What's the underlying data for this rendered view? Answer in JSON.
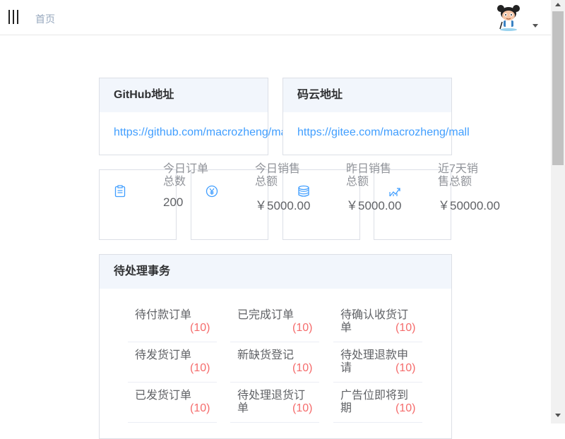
{
  "header": {
    "breadcrumb": "首页"
  },
  "addresses": [
    {
      "title": "GitHub地址",
      "link": "https://github.com/macrozheng/mall"
    },
    {
      "title": "码云地址",
      "link": "https://gitee.com/macrozheng/mall"
    }
  ],
  "stats": [
    {
      "label": "今日订单总数",
      "value": "200",
      "icon": "clipboard-icon"
    },
    {
      "label": "今日销售总额",
      "value": "￥5000.00",
      "icon": "yen-coin-icon"
    },
    {
      "label": "昨日销售总额",
      "value": "￥5000.00",
      "icon": "coin-stack-icon"
    },
    {
      "label": "近7天销售总额",
      "value": "￥50000.00",
      "icon": "trend-chart-icon"
    }
  ],
  "pending": {
    "title": "待处理事务",
    "items": [
      {
        "label": "待付款订单",
        "count": "(10)"
      },
      {
        "label": "已完成订单",
        "count": "(10)"
      },
      {
        "label": "待确认收货订单",
        "count": "(10)"
      },
      {
        "label": "待发货订单",
        "count": "(10)"
      },
      {
        "label": "新缺货登记",
        "count": "(10)"
      },
      {
        "label": "待处理退款申请",
        "count": "(10)"
      },
      {
        "label": "已发货订单",
        "count": "(10)"
      },
      {
        "label": "待处理退货订单",
        "count": "(10)"
      },
      {
        "label": "广告位即将到期",
        "count": "(10)"
      }
    ]
  },
  "colors": {
    "link": "#409eff",
    "count": "#f56c6c",
    "header_bg": "#f2f6fc",
    "border": "#dcdfe6"
  }
}
